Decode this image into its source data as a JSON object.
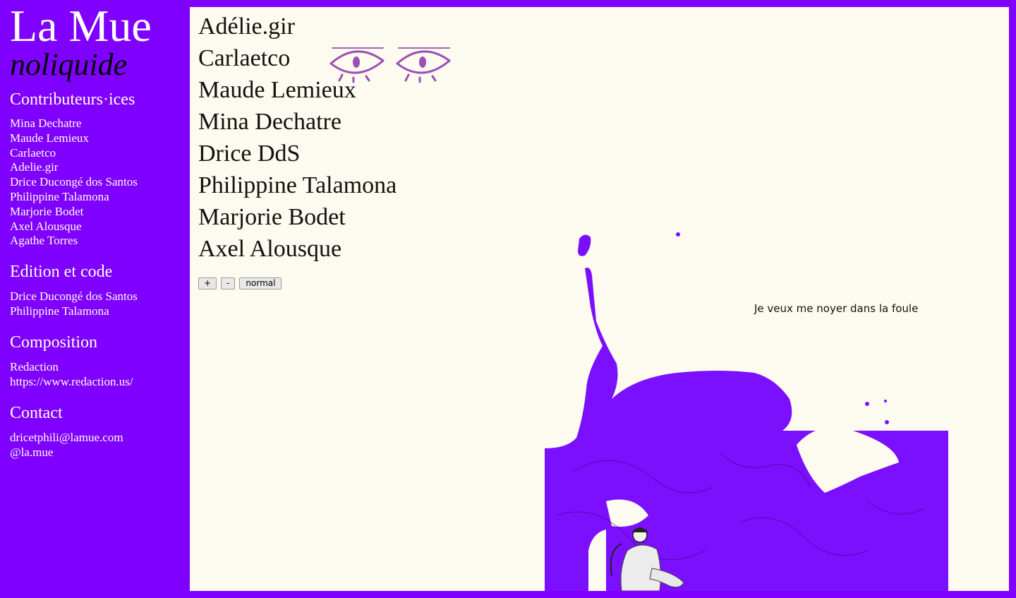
{
  "brand": {
    "title": "La Mue",
    "subtitle": "noliquide"
  },
  "sidebar": {
    "contributors_title": "Contributeurs·ices",
    "contributors": [
      "Mina Dechatre",
      "Maude Lemieux",
      "Carlaetco",
      "Adelie.gir",
      "Drice Ducongé dos Santos",
      "Philippine Talamona",
      "Marjorie Bodet",
      "Axel Alousque",
      "Agathe Torres"
    ],
    "edition_title": "Edition et code",
    "edition": [
      "Drice Ducongé dos Santos",
      "Philippine Talamona"
    ],
    "composition_title": "Composition",
    "composition": [
      "Redaction",
      "https://www.redaction.us/"
    ],
    "contact_title": "Contact",
    "contact": [
      "dricetphili@lamue.com",
      "@la.mue"
    ]
  },
  "main": {
    "names": [
      "Adélie.gir",
      "Carlaetco",
      "Maude Lemieux",
      "Mina Dechatre",
      "Drice DdS",
      "Philippine Talamona",
      "Marjorie Bodet",
      "Axel Alousque"
    ],
    "controls": {
      "plus": "+",
      "minus": "-",
      "normal": "normal"
    },
    "caption": "Je veux me noyer dans la foule"
  },
  "colors": {
    "accent": "#8000ff",
    "paper": "#fdfbf0",
    "ink": "#111111",
    "eye": "#9b50b5"
  },
  "icons": [
    "eye-icon",
    "eye-icon"
  ]
}
